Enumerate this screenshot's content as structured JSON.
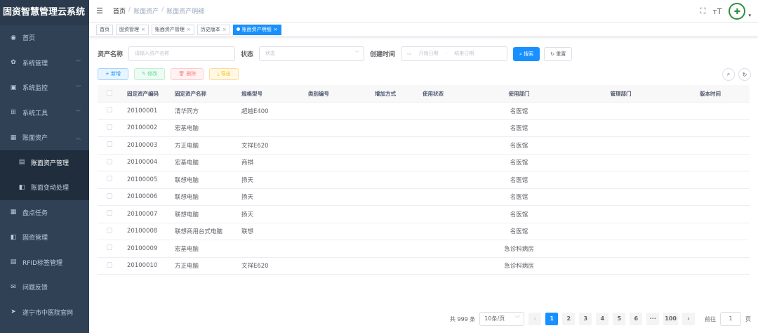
{
  "app_title": "固资智慧管理云系统",
  "sidebar": {
    "items": [
      {
        "label": "首页",
        "icon": "dashboard-icon",
        "glyph": "◉"
      },
      {
        "label": "系统管理",
        "icon": "gear-icon",
        "glyph": "✿"
      },
      {
        "label": "系统监控",
        "icon": "monitor-icon",
        "glyph": "▣"
      },
      {
        "label": "系统工具",
        "icon": "tool-icon",
        "glyph": "⊞"
      },
      {
        "label": "账面资产",
        "icon": "list-icon",
        "glyph": "▦"
      },
      {
        "label": "账面资产管理",
        "icon": "doc-icon",
        "glyph": "▤"
      },
      {
        "label": "账面变动处理",
        "icon": "copy-icon",
        "glyph": "◧"
      },
      {
        "label": "盘点任务",
        "icon": "task-icon",
        "glyph": "▦"
      },
      {
        "label": "固资管理",
        "icon": "copy-icon",
        "glyph": "◧"
      },
      {
        "label": "RFID标签管理",
        "icon": "tag-icon",
        "glyph": "▤"
      },
      {
        "label": "问题反馈",
        "icon": "mail-icon",
        "glyph": "✉"
      },
      {
        "label": "遂宁市中医院官网",
        "icon": "send-icon",
        "glyph": "➤"
      }
    ]
  },
  "header": {
    "breadcrumb": [
      "首页",
      "账面资产",
      "账面资产明细"
    ]
  },
  "tags": [
    "首页",
    "固资管理",
    "账面资产管理",
    "历史版本",
    "账面资产明细"
  ],
  "search": {
    "asset_name_label": "资产名称",
    "asset_name_placeholder": "请输入资产名称",
    "status_label": "状态",
    "status_placeholder": "状态",
    "created_label": "创建时间",
    "start_placeholder": "开始日期",
    "range_sep": "-",
    "end_placeholder": "结束日期",
    "search_btn": "搜索",
    "reset_btn": "重置"
  },
  "toolbar": {
    "add": "新增",
    "edit": "修改",
    "delete": "删除",
    "export": "导出"
  },
  "table": {
    "columns": [
      "固定资产编码",
      "固定资产名称",
      "规格型号",
      "类别编号",
      "增加方式",
      "使用状态",
      "使用部门",
      "管理部门",
      "版本时间"
    ],
    "rows": [
      {
        "code": "20100001",
        "name": "清华同方",
        "spec": "超越E400",
        "dept": "名医馆"
      },
      {
        "code": "20100002",
        "name": "宏基电脑",
        "spec": "",
        "dept": "名医馆"
      },
      {
        "code": "20100003",
        "name": "方正电脑",
        "spec": "文祥E620",
        "dept": "名医馆"
      },
      {
        "code": "20100004",
        "name": "宏基电脑",
        "spec": "商祺",
        "dept": "名医馆"
      },
      {
        "code": "20100005",
        "name": "联想电脑",
        "spec": "扬天",
        "dept": "名医馆"
      },
      {
        "code": "20100006",
        "name": "联想电脑",
        "spec": "扬天",
        "dept": "名医馆"
      },
      {
        "code": "20100007",
        "name": "联想电脑",
        "spec": "扬天",
        "dept": "名医馆"
      },
      {
        "code": "20100008",
        "name": "联想商用台式电脑",
        "spec": "联想",
        "dept": "名医馆"
      },
      {
        "code": "20100009",
        "name": "宏基电脑",
        "spec": "",
        "dept": "急诊科病房"
      },
      {
        "code": "20100010",
        "name": "方正电脑",
        "spec": "文祥E620",
        "dept": "急诊科病房"
      }
    ]
  },
  "pagination": {
    "total": "共 999 条",
    "page_size": "10条/页",
    "pages": [
      "1",
      "2",
      "3",
      "4",
      "5",
      "6",
      "···",
      "100"
    ],
    "current": "1",
    "goto_label": "前往",
    "goto_value": "1",
    "goto_suffix": "页"
  },
  "colors": {
    "primary": "#1890ff",
    "sidebar_bg": "#304156"
  }
}
